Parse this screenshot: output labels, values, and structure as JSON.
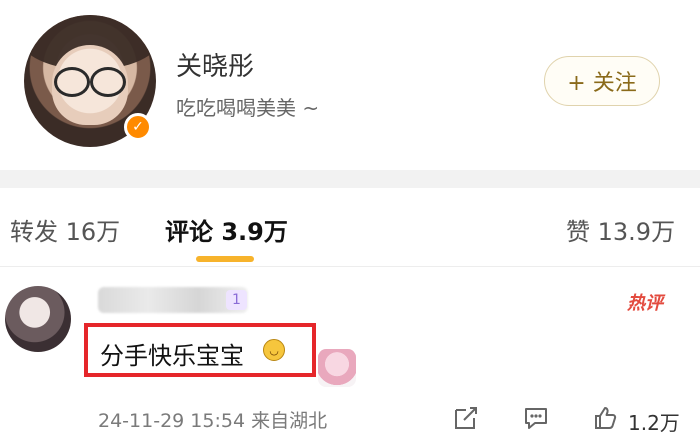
{
  "profile": {
    "username": "关晓彤",
    "bio": "吃吃喝喝美美 ~",
    "follow_button": "+ 关注"
  },
  "tabs": {
    "reposts": "转发 16万",
    "comments": "评论 3.9万",
    "likes": "赞 13.9万"
  },
  "comment": {
    "level_badge": "1",
    "hot_tag": "热评",
    "text": "分手快乐宝宝",
    "meta": "24-11-29 15:54 来自湖北",
    "like_count": "1.2万"
  },
  "colors": {
    "accent": "#f7b32b",
    "highlight_box": "#e5262a",
    "verified": "#ff8a00"
  }
}
